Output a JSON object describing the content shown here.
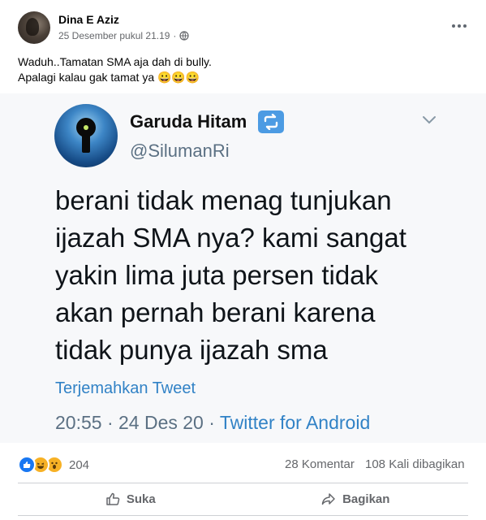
{
  "post": {
    "author": "Dina E Aziz",
    "timestamp": "25 Desember pukul 21.19",
    "separator": "·",
    "text_lines": [
      "Waduh..Tamatan SMA aja dah di bully.",
      "Apalagi kalau gak tamat ya 😀😀😀"
    ]
  },
  "tweet": {
    "name": "Garuda Hitam",
    "handle": "@SilumanRi",
    "body_lines": [
      "berani tidak menag tunjukan",
      "ijazah SMA nya? kami sangat",
      "yakin lima juta persen tidak",
      "akan pernah berani karena",
      "tidak punya ijazah sma"
    ],
    "translate_label": "Terjemahkan Tweet",
    "time": "20:55 · 24 Des 20 · ",
    "source": "Twitter for Android"
  },
  "stats": {
    "reaction_count": "204",
    "comments": "28 Komentar",
    "shares": "108 Kali dibagikan"
  },
  "actions": {
    "like_label": "Suka",
    "share_label": "Bagikan"
  },
  "icons": {
    "globe": "globe-icon",
    "more": "more-icon",
    "retweet": "retweet-icon",
    "chevron": "chevron-down-icon",
    "like": "thumbs-up-icon",
    "share": "share-arrow-icon"
  },
  "colors": {
    "link_blue": "#3182c6",
    "fb_blue": "#1877f2",
    "muted": "#65676b"
  }
}
